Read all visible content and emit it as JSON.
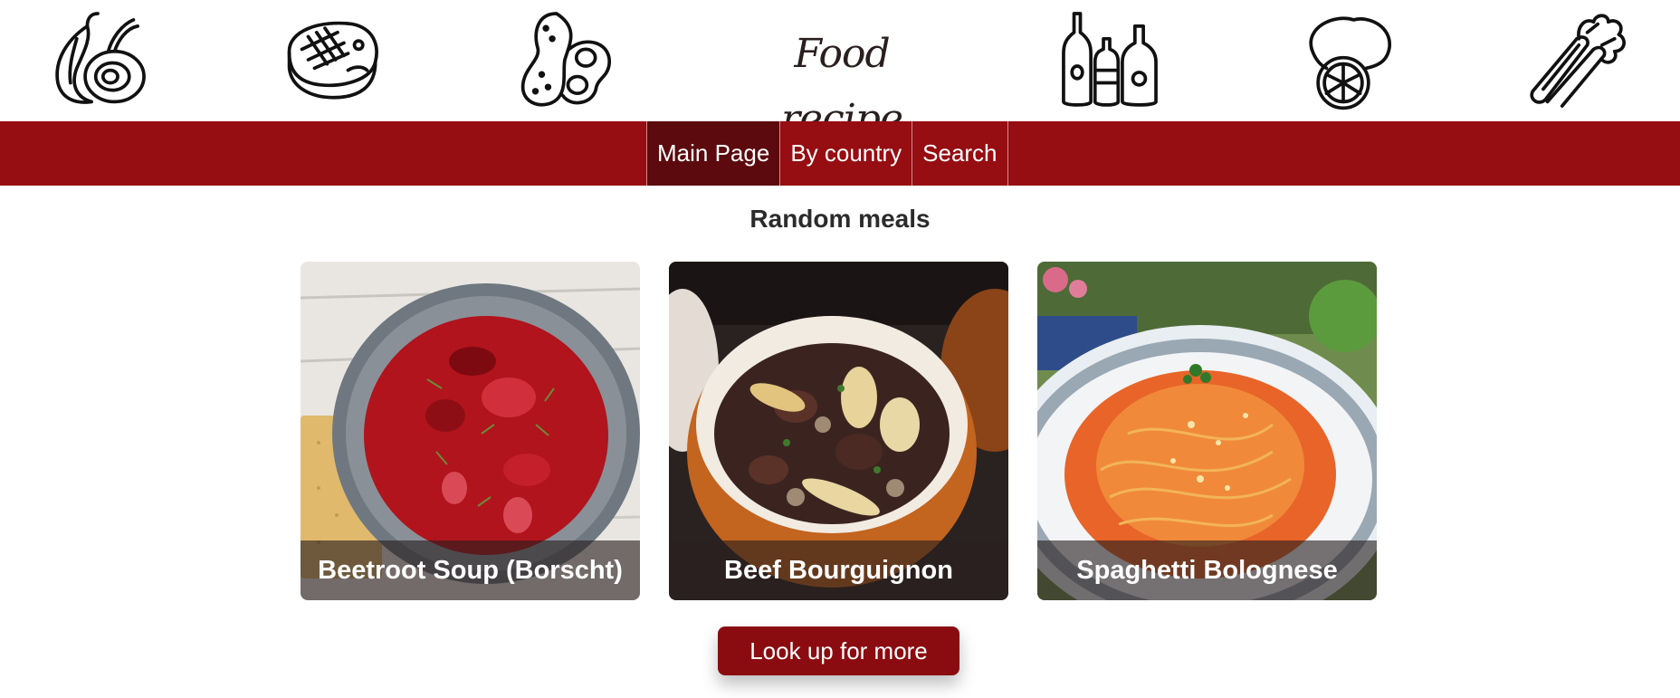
{
  "header": {
    "logo_text": "Food recipe",
    "icons": [
      "onion-icon",
      "steak-icon",
      "peanut-icon",
      "condiments-icon",
      "lemon-icon",
      "celery-icon"
    ]
  },
  "nav": {
    "items": [
      {
        "label": "Main Page",
        "active": true
      },
      {
        "label": "By country",
        "active": false
      },
      {
        "label": "Search",
        "active": false
      }
    ]
  },
  "main": {
    "title": "Random meals",
    "meals": [
      {
        "name": "Beetroot Soup (Borscht)"
      },
      {
        "name": "Beef Bourguignon"
      },
      {
        "name": "Spaghetti Bolognese"
      }
    ],
    "more_button_label": "Look up for more"
  },
  "colors": {
    "nav_background": "#960d12",
    "nav_active": "#5c0a0d",
    "button_background": "#8a0c10"
  }
}
